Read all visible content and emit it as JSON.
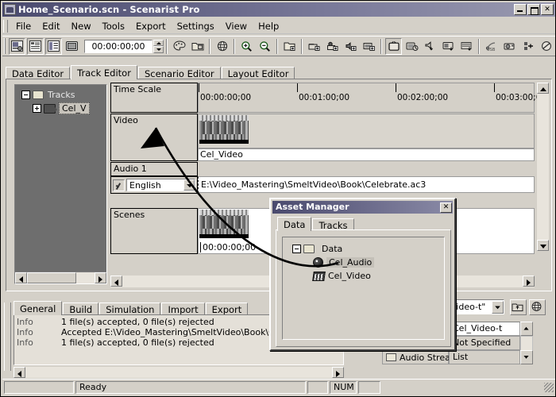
{
  "window": {
    "title": "Home_Scenario.scn - Scenarist Pro",
    "app_icon": "app-icon",
    "minimize": "_",
    "maximize": "□",
    "close": "✕"
  },
  "menu": {
    "items": [
      "File",
      "Edit",
      "New",
      "Tools",
      "Export",
      "Settings",
      "View",
      "Help"
    ]
  },
  "toolbar": {
    "timecode_value": "00:00:00;00",
    "buttons": [
      "data-editor-icon",
      "track-editor-icon",
      "scenario-editor-icon",
      "layout-editor-icon",
      "palette-icon",
      "folder-properties-icon",
      "globe-icon",
      "zoom-in-icon",
      "zoom-out-icon",
      "new-folder-icon",
      "add-still-icon",
      "add-subtitle-icon",
      "add-audio-icon",
      "add-video-icon",
      "preview-tv-icon",
      "simulate-icon",
      "audio-out-icon",
      "video-out-icon",
      "multiplex-icon",
      "usb-write-icon",
      "write-disc-icon",
      "layout-icon",
      "verify-icon"
    ]
  },
  "tabs": {
    "items": [
      "Data Editor",
      "Track Editor",
      "Scenario Editor",
      "Layout Editor"
    ],
    "active": "Track Editor"
  },
  "tree": {
    "root_label": "Tracks",
    "child_label": "Cel_V",
    "root_toggle": "minus-box-icon",
    "child_toggle": "plus-box-icon"
  },
  "timeline": {
    "rows": [
      {
        "header": "Time Scale"
      },
      {
        "header": "Video",
        "clip_label": "Cel_Video"
      },
      {
        "header": "Audio 1",
        "language": "English",
        "path": "E:\\Video_Mastering\\SmeltVideo\\Book\\Celebrate.ac3"
      },
      {
        "header": "Scenes",
        "clip_timecode": "00:00:00;00"
      }
    ],
    "ruler_labels": [
      "00:00:00;00",
      "00:01:00;00",
      "00:02:00;00",
      "00:03:00;00"
    ]
  },
  "asset_manager": {
    "title": "Asset Manager",
    "close_label": "✕",
    "tabs": [
      "Data",
      "Tracks"
    ],
    "active_tab": "Data",
    "tree": {
      "root": "Data",
      "root_toggle": "minus-box-icon",
      "items": [
        {
          "label": "Cel_Audio",
          "icon": "audio-disc-icon",
          "selected": true
        },
        {
          "label": "Cel_Video",
          "icon": "film-strip-icon",
          "selected": false
        }
      ]
    }
  },
  "log": {
    "tabs": [
      "General",
      "Build",
      "Simulation",
      "Import",
      "Export"
    ],
    "active_tab": "General",
    "lines": [
      {
        "severity": "Info",
        "message": "1 file(s) accepted, 0 file(s) rejected"
      },
      {
        "severity": "Info",
        "message": "Accepted E:\\Video_Mastering\\SmeltVideo\\Book\\Celebrate"
      },
      {
        "severity": "Info",
        "message": "1 file(s) accepted, 0 file(s) rejected"
      }
    ]
  },
  "right_panel": {
    "combo_value": "Video-t\"",
    "up_button": "up-folder-icon",
    "globe_button": "globe-icon",
    "grid": {
      "name_value": "Cel_Video-t",
      "rows": [
        {
          "label": "",
          "value": "Not Specified"
        },
        {
          "label": "Audio Streams",
          "value": "List"
        }
      ]
    }
  },
  "statusbar": {
    "message": "Ready",
    "indicators": [
      "NUM"
    ]
  }
}
